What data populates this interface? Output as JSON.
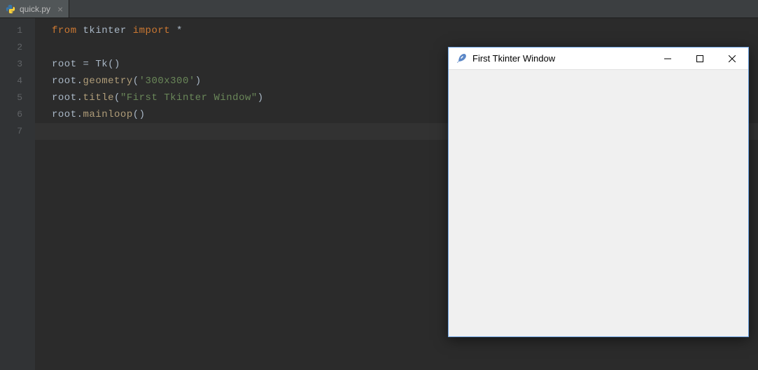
{
  "tab": {
    "filename": "quick.py",
    "close_symbol": "×"
  },
  "gutter": {
    "lines": [
      "1",
      "2",
      "3",
      "4",
      "5",
      "6",
      "7"
    ]
  },
  "code": {
    "l1_from": "from",
    "l1_tkinter": " tkinter ",
    "l1_import": "import",
    "l1_star": " *",
    "l3_root": "root ",
    "l3_eq": "=",
    "l3_tk": " Tk()",
    "l4_root": "root.",
    "l4_geom": "geometry",
    "l4_open": "(",
    "l4_str": "'300x300'",
    "l4_close": ")",
    "l5_root": "root.",
    "l5_title": "title",
    "l5_open": "(",
    "l5_str": "\"First Tkinter Window\"",
    "l5_close": ")",
    "l6_root": "root.",
    "l6_main": "mainloop",
    "l6_par": "()"
  },
  "tk_window": {
    "title": "First Tkinter Window"
  }
}
